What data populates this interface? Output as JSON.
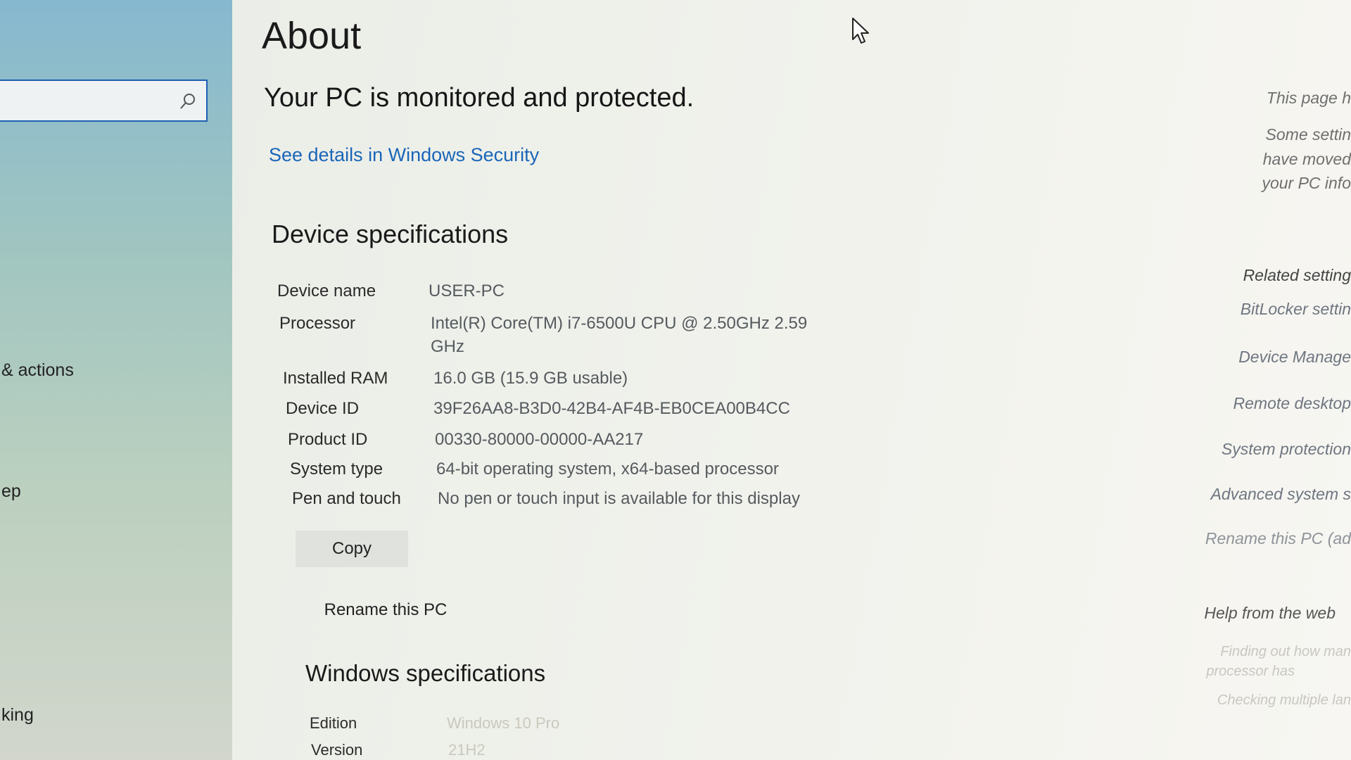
{
  "sidebar": {
    "search": {
      "value": "",
      "icon": "search-icon"
    },
    "items": [
      {
        "label": "& actions"
      },
      {
        "label": "ep"
      },
      {
        "label": "king"
      }
    ]
  },
  "main": {
    "title": "About",
    "protection_heading": "Your PC is monitored and protected.",
    "security_link": "See details in Windows Security",
    "device_specs": {
      "heading": "Device specifications",
      "rows": [
        {
          "label": "Device name",
          "value": "USER-PC"
        },
        {
          "label": "Processor",
          "value": "Intel(R) Core(TM) i7-6500U CPU @ 2.50GHz   2.59",
          "value_line2": "GHz"
        },
        {
          "label": "Installed RAM",
          "value": "16.0 GB (15.9 GB usable)"
        },
        {
          "label": "Device ID",
          "value": "39F26AA8-B3D0-42B4-AF4B-EB0CEA00B4CC"
        },
        {
          "label": "Product ID",
          "value": "00330-80000-00000-AA217"
        },
        {
          "label": "System type",
          "value": "64-bit operating system, x64-based processor"
        },
        {
          "label": "Pen and touch",
          "value": "No pen or touch input is available for this display"
        }
      ],
      "copy_button": "Copy",
      "rename_button": "Rename this PC"
    },
    "windows_specs": {
      "heading": "Windows specifications",
      "rows": [
        {
          "label": "Edition",
          "value": "Windows 10 Pro"
        },
        {
          "label": "Version",
          "value": "21H2"
        }
      ]
    }
  },
  "right_panel": {
    "notice_title": "This page h",
    "notice_lines": [
      "Some settin",
      "have moved",
      "your PC info"
    ],
    "related_heading": "Related setting",
    "related_links": [
      "BitLocker settin",
      "Device Manage",
      "Remote desktop",
      "System protection",
      "Advanced system s",
      "Rename this PC (ad"
    ],
    "help_heading": "Help from the web",
    "help_links": [
      "Finding out how man",
      "processor has",
      "Checking multiple lan"
    ]
  }
}
